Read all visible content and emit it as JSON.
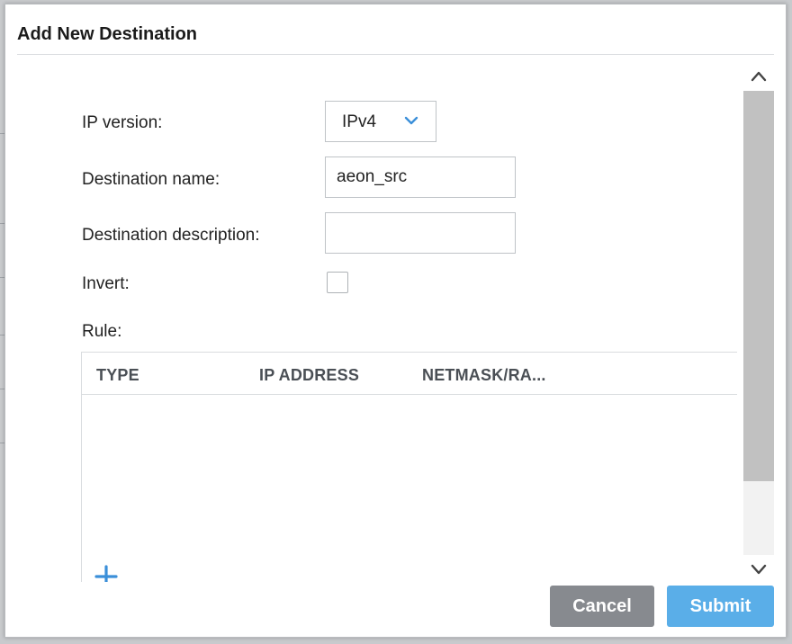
{
  "dialog": {
    "title": "Add New Destination"
  },
  "form": {
    "ip_version": {
      "label": "IP version:",
      "value": "IPv4"
    },
    "destination_name": {
      "label": "Destination name:",
      "value": "aeon_src"
    },
    "destination_description": {
      "label": "Destination description:",
      "value": ""
    },
    "invert": {
      "label": "Invert:",
      "checked": false
    },
    "rule": {
      "label": "Rule:",
      "columns": [
        "TYPE",
        "IP ADDRESS",
        "NETMASK/RA..."
      ],
      "rows": []
    }
  },
  "icons": {
    "select_chevron": "chevron-down-icon",
    "add_rule": "plus-icon",
    "scroll_up": "chevron-up-icon",
    "scroll_down": "chevron-down-icon"
  },
  "colors": {
    "accent": "#3b8fd9",
    "submit": "#5aaee8",
    "cancel": "#878a8f"
  },
  "buttons": {
    "cancel": "Cancel",
    "submit": "Submit"
  }
}
